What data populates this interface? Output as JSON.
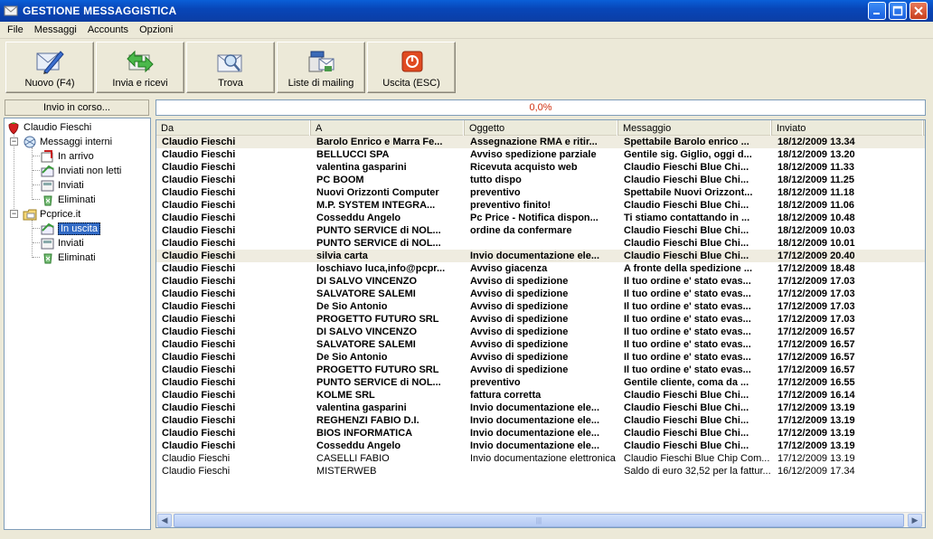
{
  "window": {
    "title": "GESTIONE MESSAGGISTICA"
  },
  "menu": [
    "File",
    "Messaggi",
    "Accounts",
    "Opzioni"
  ],
  "toolbar": {
    "new": "Nuovo (F4)",
    "sendreceive": "Invia e ricevi",
    "find": "Trova",
    "mailing": "Liste di mailing",
    "exit": "Uscita (ESC)"
  },
  "status": "Invio in corso...",
  "progress": "0,0%",
  "tree": {
    "root": "Claudio Fieschi",
    "internal": "Messaggi interni",
    "internal_items": [
      "In arrivo",
      "Inviati non letti",
      "Inviati",
      "Eliminati"
    ],
    "account": "Pcprice.it",
    "account_items": [
      "In uscita",
      "Inviati",
      "Eliminati"
    ]
  },
  "columns": [
    "Da",
    "A",
    "Oggetto",
    "Messaggio",
    "Inviato"
  ],
  "rows": [
    {
      "da": "Claudio Fieschi",
      "a": "Barolo Enrico e Marra Fe...",
      "oggetto": "Assegnazione RMA e ritir...",
      "messaggio": "Spettabile Barolo enrico ...",
      "inviato": "18/12/2009 13.34"
    },
    {
      "da": "Claudio Fieschi",
      "a": "BELLUCCI SPA",
      "oggetto": "Avviso spedizione parziale",
      "messaggio": "Gentile sig. Giglio, oggi d...",
      "inviato": "18/12/2009 13.20"
    },
    {
      "da": "Claudio Fieschi",
      "a": "valentina gasparini",
      "oggetto": "Ricevuta acquisto web",
      "messaggio": " Claudio Fieschi Blue Chi...",
      "inviato": "18/12/2009 11.33"
    },
    {
      "da": "Claudio Fieschi",
      "a": "PC BOOM",
      "oggetto": "tutto dispo",
      "messaggio": " Claudio Fieschi Blue Chi...",
      "inviato": "18/12/2009 11.25"
    },
    {
      "da": "Claudio Fieschi",
      "a": "Nuovi Orizzonti Computer",
      "oggetto": "preventivo",
      "messaggio": "Spettabile Nuovi Orizzont...",
      "inviato": "18/12/2009 11.18"
    },
    {
      "da": "Claudio Fieschi",
      "a": "M.P. SYSTEM INTEGRA...",
      "oggetto": "preventivo finito!",
      "messaggio": " Claudio Fieschi Blue Chi...",
      "inviato": "18/12/2009 11.06"
    },
    {
      "da": "Claudio Fieschi",
      "a": "Cosseddu Angelo",
      "oggetto": "Pc Price - Notifica dispon...",
      "messaggio": "Ti stiamo contattando in ...",
      "inviato": "18/12/2009 10.48"
    },
    {
      "da": "Claudio Fieschi",
      "a": "PUNTO SERVICE di NOL...",
      "oggetto": "ordine da confermare",
      "messaggio": " Claudio Fieschi Blue Chi...",
      "inviato": "18/12/2009 10.03"
    },
    {
      "da": "Claudio Fieschi",
      "a": "PUNTO SERVICE di NOL...",
      "oggetto": "",
      "messaggio": " Claudio Fieschi Blue Chi...",
      "inviato": "18/12/2009 10.01"
    },
    {
      "da": "Claudio Fieschi",
      "a": "silvia carta",
      "oggetto": "Invio documentazione ele...",
      "messaggio": " Claudio Fieschi Blue Chi...",
      "inviato": "17/12/2009 20.40"
    },
    {
      "da": "Claudio Fieschi",
      "a": "loschiavo luca,info@pcpr...",
      "oggetto": "Avviso giacenza",
      "messaggio": "A fronte della spedizione ...",
      "inviato": "17/12/2009 18.48"
    },
    {
      "da": "Claudio Fieschi",
      "a": "DI SALVO VINCENZO",
      "oggetto": "Avviso di spedizione",
      "messaggio": "Il tuo ordine e' stato evas...",
      "inviato": "17/12/2009 17.03"
    },
    {
      "da": "Claudio Fieschi",
      "a": "SALVATORE SALEMI",
      "oggetto": "Avviso di spedizione",
      "messaggio": "Il tuo ordine e' stato evas...",
      "inviato": "17/12/2009 17.03"
    },
    {
      "da": "Claudio Fieschi",
      "a": "De Sio Antonio",
      "oggetto": "Avviso di spedizione",
      "messaggio": "Il tuo ordine e' stato evas...",
      "inviato": "17/12/2009 17.03"
    },
    {
      "da": "Claudio Fieschi",
      "a": "PROGETTO FUTURO SRL",
      "oggetto": "Avviso di spedizione",
      "messaggio": "Il tuo ordine e' stato evas...",
      "inviato": "17/12/2009 17.03"
    },
    {
      "da": "Claudio Fieschi",
      "a": "DI SALVO VINCENZO",
      "oggetto": "Avviso di spedizione",
      "messaggio": "Il tuo ordine e' stato evas...",
      "inviato": "17/12/2009 16.57"
    },
    {
      "da": "Claudio Fieschi",
      "a": "SALVATORE SALEMI",
      "oggetto": "Avviso di spedizione",
      "messaggio": "Il tuo ordine e' stato evas...",
      "inviato": "17/12/2009 16.57"
    },
    {
      "da": "Claudio Fieschi",
      "a": "De Sio Antonio",
      "oggetto": "Avviso di spedizione",
      "messaggio": "Il tuo ordine e' stato evas...",
      "inviato": "17/12/2009 16.57"
    },
    {
      "da": "Claudio Fieschi",
      "a": "PROGETTO FUTURO SRL",
      "oggetto": "Avviso di spedizione",
      "messaggio": "Il tuo ordine e' stato evas...",
      "inviato": "17/12/2009 16.57"
    },
    {
      "da": "Claudio Fieschi",
      "a": "PUNTO SERVICE di NOL...",
      "oggetto": "preventivo",
      "messaggio": "Gentile cliente, coma da ...",
      "inviato": "17/12/2009 16.55"
    },
    {
      "da": "Claudio Fieschi",
      "a": "KOLME SRL",
      "oggetto": "fattura corretta",
      "messaggio": " Claudio Fieschi Blue Chi...",
      "inviato": "17/12/2009 16.14"
    },
    {
      "da": "Claudio Fieschi",
      "a": "valentina gasparini",
      "oggetto": "Invio documentazione ele...",
      "messaggio": " Claudio Fieschi Blue Chi...",
      "inviato": "17/12/2009 13.19"
    },
    {
      "da": "Claudio Fieschi",
      "a": "REGHENZI  FABIO  D.I.",
      "oggetto": "Invio documentazione ele...",
      "messaggio": " Claudio Fieschi Blue Chi...",
      "inviato": "17/12/2009 13.19"
    },
    {
      "da": "Claudio Fieschi",
      "a": "BIOS INFORMATICA",
      "oggetto": "Invio documentazione ele...",
      "messaggio": " Claudio Fieschi Blue Chi...",
      "inviato": "17/12/2009 13.19"
    },
    {
      "da": "Claudio Fieschi",
      "a": "Cosseddu Angelo",
      "oggetto": "Invio documentazione ele...",
      "messaggio": " Claudio Fieschi Blue Chi...",
      "inviato": "17/12/2009 13.19"
    },
    {
      "da": "Claudio Fieschi",
      "a": "CASELLI FABIO",
      "oggetto": "Invio documentazione elettronica",
      "messaggio": " Claudio Fieschi Blue Chip Com...",
      "inviato": "17/12/2009 13.19"
    },
    {
      "da": "Claudio Fieschi",
      "a": "MISTERWEB",
      "oggetto": "",
      "messaggio": "Saldo di euro 32,52 per la fattur...",
      "inviato": "16/12/2009 17.34"
    }
  ],
  "bold_rows": 25,
  "highlighted_rows": [
    0,
    9
  ]
}
